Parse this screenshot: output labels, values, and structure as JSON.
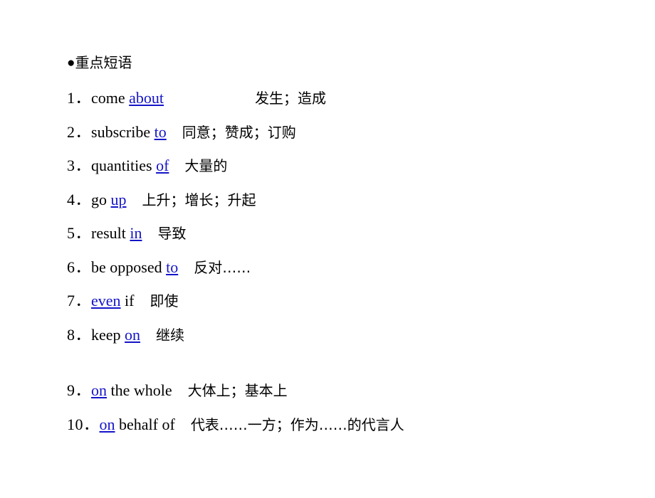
{
  "slide": {
    "heading": {
      "bullet": "●",
      "text": "重点短语"
    },
    "items": [
      {
        "num": "1．",
        "before": "come ",
        "key": "about",
        "after": "",
        "gap": "wide",
        "cn": "发生；造成"
      },
      {
        "num": "2．",
        "before": "subscribe ",
        "key": "to",
        "after": "",
        "gap": "md",
        "cn": "同意；赞成；订购"
      },
      {
        "num": "3．",
        "before": "quantities ",
        "key": "of",
        "after": "",
        "gap": "md",
        "cn": "大量的"
      },
      {
        "num": "4．",
        "before": "go ",
        "key": "up",
        "after": "",
        "gap": "md",
        "cn": "上升；增长；升起"
      },
      {
        "num": "5．",
        "before": "result ",
        "key": "in",
        "after": "",
        "gap": "md",
        "cn": "导致"
      },
      {
        "num": "6．",
        "before": "be opposed ",
        "key": "to",
        "after": "",
        "gap": "md",
        "cn": "反对……"
      },
      {
        "num": "7．",
        "before": "",
        "key": "even",
        "after": " if",
        "gap": "md",
        "cn": "即使"
      },
      {
        "num": "8．",
        "before": "keep ",
        "key": "on",
        "after": "",
        "gap": "md",
        "cn": "继续"
      },
      {
        "num": "9．",
        "before": "",
        "key": "on",
        "after": " the whole",
        "gap": "md",
        "cn": "大体上；基本上"
      },
      {
        "num": "10．",
        "before": "",
        "key": "on",
        "after": " behalf of",
        "gap": "md",
        "cn": "代表……一方；作为……的代言人"
      }
    ],
    "colors": {
      "key_link": "#1414c8",
      "text": "#000000",
      "background": "#ffffff"
    }
  }
}
